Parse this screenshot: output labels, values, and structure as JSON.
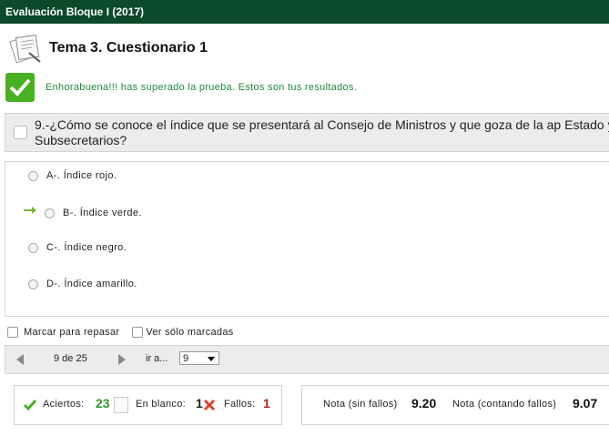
{
  "window": {
    "title": "Evaluación Bloque I (2017)"
  },
  "header": {
    "title": "Tema 3. Cuestionario 1"
  },
  "result": {
    "message": "Enhorabuena!!! has superado la prueba. Estos son tus resultados."
  },
  "question": {
    "text": "9.-¿Cómo se conoce el índice que se presentará al Consejo de Ministros y que goza de la ap Estado y Subsecretarios?",
    "answers": [
      {
        "label": "A-. Índice rojo.",
        "marked_correct": false
      },
      {
        "label": "B-. Índice verde.",
        "marked_correct": true
      },
      {
        "label": "C-. Índice negro.",
        "marked_correct": false
      },
      {
        "label": "D-. Índice amarillo.",
        "marked_correct": false
      }
    ]
  },
  "options": {
    "mark_review": "Marcar para repasar",
    "show_marked": "Ver sólo marcadas"
  },
  "navigation": {
    "position": "9 de 25",
    "goto_label": "ir a...",
    "goto_value": "9"
  },
  "stats": {
    "aciertos_label": "Aciertos:",
    "aciertos_value": "23",
    "blanco_label": "En blanco:",
    "blanco_value": "1",
    "fallos_label": "Fallos:",
    "fallos_value": "1",
    "nota_sin_label": "Nota (sin fallos)",
    "nota_sin_value": "9.20",
    "nota_con_label": "Nota (contando fallos)",
    "nota_con_value": "9.07"
  },
  "colors": {
    "topbar": "#0b4a2a",
    "success": "#1f8a3a",
    "accent_green": "#49b022",
    "fail_red": "#b22222"
  },
  "icons": [
    "quiz-icon",
    "checkmark-icon",
    "correct-arrow-icon",
    "prev-arrow-icon",
    "next-arrow-icon",
    "blank-icon",
    "cross-icon"
  ]
}
